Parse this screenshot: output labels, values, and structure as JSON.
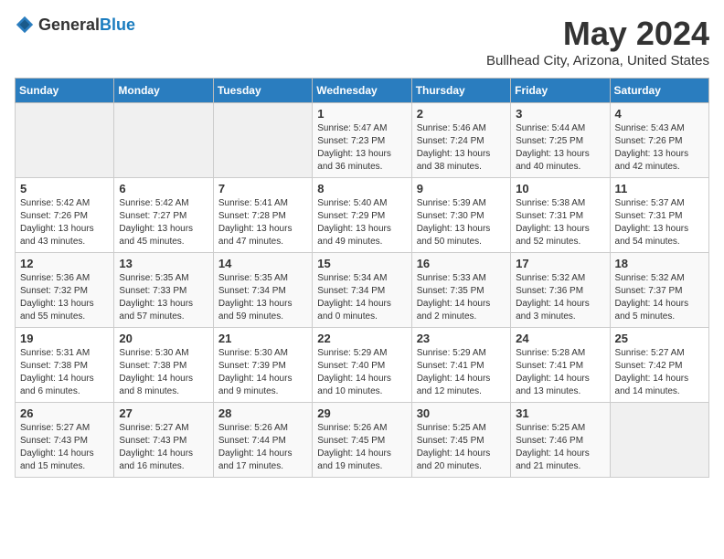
{
  "header": {
    "logo_general": "General",
    "logo_blue": "Blue",
    "month": "May 2024",
    "location": "Bullhead City, Arizona, United States"
  },
  "days_of_week": [
    "Sunday",
    "Monday",
    "Tuesday",
    "Wednesday",
    "Thursday",
    "Friday",
    "Saturday"
  ],
  "weeks": [
    [
      {
        "day": "",
        "info": ""
      },
      {
        "day": "",
        "info": ""
      },
      {
        "day": "",
        "info": ""
      },
      {
        "day": "1",
        "info": "Sunrise: 5:47 AM\nSunset: 7:23 PM\nDaylight: 13 hours and 36 minutes."
      },
      {
        "day": "2",
        "info": "Sunrise: 5:46 AM\nSunset: 7:24 PM\nDaylight: 13 hours and 38 minutes."
      },
      {
        "day": "3",
        "info": "Sunrise: 5:44 AM\nSunset: 7:25 PM\nDaylight: 13 hours and 40 minutes."
      },
      {
        "day": "4",
        "info": "Sunrise: 5:43 AM\nSunset: 7:26 PM\nDaylight: 13 hours and 42 minutes."
      }
    ],
    [
      {
        "day": "5",
        "info": "Sunrise: 5:42 AM\nSunset: 7:26 PM\nDaylight: 13 hours and 43 minutes."
      },
      {
        "day": "6",
        "info": "Sunrise: 5:42 AM\nSunset: 7:27 PM\nDaylight: 13 hours and 45 minutes."
      },
      {
        "day": "7",
        "info": "Sunrise: 5:41 AM\nSunset: 7:28 PM\nDaylight: 13 hours and 47 minutes."
      },
      {
        "day": "8",
        "info": "Sunrise: 5:40 AM\nSunset: 7:29 PM\nDaylight: 13 hours and 49 minutes."
      },
      {
        "day": "9",
        "info": "Sunrise: 5:39 AM\nSunset: 7:30 PM\nDaylight: 13 hours and 50 minutes."
      },
      {
        "day": "10",
        "info": "Sunrise: 5:38 AM\nSunset: 7:31 PM\nDaylight: 13 hours and 52 minutes."
      },
      {
        "day": "11",
        "info": "Sunrise: 5:37 AM\nSunset: 7:31 PM\nDaylight: 13 hours and 54 minutes."
      }
    ],
    [
      {
        "day": "12",
        "info": "Sunrise: 5:36 AM\nSunset: 7:32 PM\nDaylight: 13 hours and 55 minutes."
      },
      {
        "day": "13",
        "info": "Sunrise: 5:35 AM\nSunset: 7:33 PM\nDaylight: 13 hours and 57 minutes."
      },
      {
        "day": "14",
        "info": "Sunrise: 5:35 AM\nSunset: 7:34 PM\nDaylight: 13 hours and 59 minutes."
      },
      {
        "day": "15",
        "info": "Sunrise: 5:34 AM\nSunset: 7:34 PM\nDaylight: 14 hours and 0 minutes."
      },
      {
        "day": "16",
        "info": "Sunrise: 5:33 AM\nSunset: 7:35 PM\nDaylight: 14 hours and 2 minutes."
      },
      {
        "day": "17",
        "info": "Sunrise: 5:32 AM\nSunset: 7:36 PM\nDaylight: 14 hours and 3 minutes."
      },
      {
        "day": "18",
        "info": "Sunrise: 5:32 AM\nSunset: 7:37 PM\nDaylight: 14 hours and 5 minutes."
      }
    ],
    [
      {
        "day": "19",
        "info": "Sunrise: 5:31 AM\nSunset: 7:38 PM\nDaylight: 14 hours and 6 minutes."
      },
      {
        "day": "20",
        "info": "Sunrise: 5:30 AM\nSunset: 7:38 PM\nDaylight: 14 hours and 8 minutes."
      },
      {
        "day": "21",
        "info": "Sunrise: 5:30 AM\nSunset: 7:39 PM\nDaylight: 14 hours and 9 minutes."
      },
      {
        "day": "22",
        "info": "Sunrise: 5:29 AM\nSunset: 7:40 PM\nDaylight: 14 hours and 10 minutes."
      },
      {
        "day": "23",
        "info": "Sunrise: 5:29 AM\nSunset: 7:41 PM\nDaylight: 14 hours and 12 minutes."
      },
      {
        "day": "24",
        "info": "Sunrise: 5:28 AM\nSunset: 7:41 PM\nDaylight: 14 hours and 13 minutes."
      },
      {
        "day": "25",
        "info": "Sunrise: 5:27 AM\nSunset: 7:42 PM\nDaylight: 14 hours and 14 minutes."
      }
    ],
    [
      {
        "day": "26",
        "info": "Sunrise: 5:27 AM\nSunset: 7:43 PM\nDaylight: 14 hours and 15 minutes."
      },
      {
        "day": "27",
        "info": "Sunrise: 5:27 AM\nSunset: 7:43 PM\nDaylight: 14 hours and 16 minutes."
      },
      {
        "day": "28",
        "info": "Sunrise: 5:26 AM\nSunset: 7:44 PM\nDaylight: 14 hours and 17 minutes."
      },
      {
        "day": "29",
        "info": "Sunrise: 5:26 AM\nSunset: 7:45 PM\nDaylight: 14 hours and 19 minutes."
      },
      {
        "day": "30",
        "info": "Sunrise: 5:25 AM\nSunset: 7:45 PM\nDaylight: 14 hours and 20 minutes."
      },
      {
        "day": "31",
        "info": "Sunrise: 5:25 AM\nSunset: 7:46 PM\nDaylight: 14 hours and 21 minutes."
      },
      {
        "day": "",
        "info": ""
      }
    ]
  ]
}
